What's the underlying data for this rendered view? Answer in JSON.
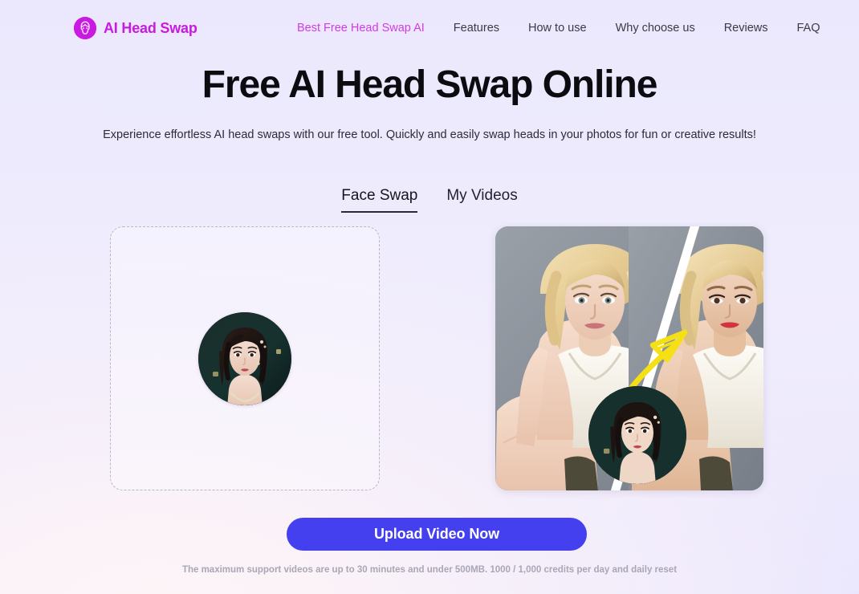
{
  "brand": {
    "name": "AI Head Swap",
    "icon": "head-swap-logo-icon",
    "color": "#c81ae0"
  },
  "nav": {
    "items": [
      {
        "label": "Best Free Head Swap AI",
        "active": true
      },
      {
        "label": "Features",
        "active": false
      },
      {
        "label": "How to use",
        "active": false
      },
      {
        "label": "Why choose us",
        "active": false
      },
      {
        "label": "Reviews",
        "active": false
      },
      {
        "label": "FAQ",
        "active": false
      }
    ]
  },
  "hero": {
    "title": "Free AI Head Swap Online",
    "subtitle": "Experience effortless AI head swaps with our free tool. Quickly and easily swap heads in your photos for fun or creative results!"
  },
  "tabs": [
    {
      "label": "Face Swap",
      "active": true
    },
    {
      "label": "My Videos",
      "active": false
    }
  ],
  "workspace": {
    "dropzone": {
      "name": "upload-dropzone",
      "thumbnail_alt": "uploaded-face-photo"
    },
    "preview": {
      "name": "before-after-preview",
      "annotation": "yellow-swap-arrow",
      "overlay_alt": "source-face-circle"
    }
  },
  "cta": {
    "label": "Upload Video Now",
    "color": "#4440ef"
  },
  "fineprint": "The maximum support videos are up to 30 minutes and under 500MB. 1000 / 1,000 credits per day and daily reset"
}
